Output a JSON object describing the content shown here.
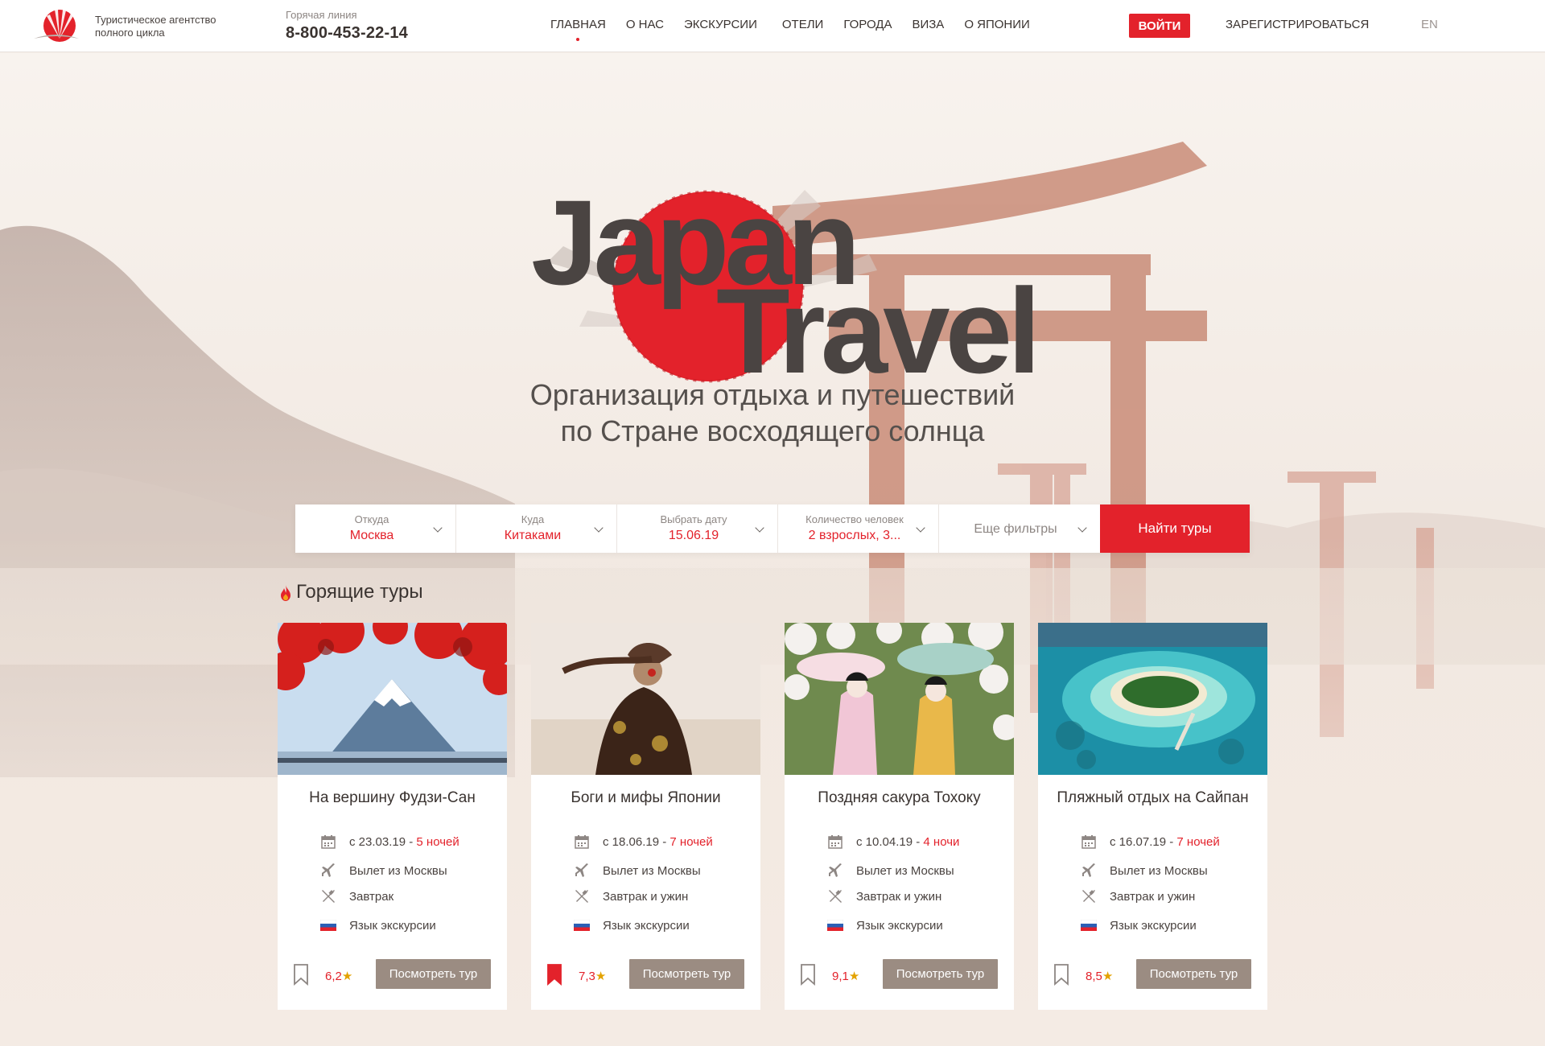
{
  "header": {
    "tagline": "Туристическое агентство полного цикла",
    "hotline_label": "Горячая линия",
    "hotline_number": "8-800-453-22-14",
    "nav": [
      "ГЛАВНАЯ",
      "О НАС",
      "ЭКСКУРСИИ",
      "ОТЕЛИ",
      "ГОРОДА",
      "ВИЗА",
      "О ЯПОНИИ"
    ],
    "active_nav": "ГЛАВНАЯ",
    "login": "ВОЙТИ",
    "register": "ЗАРЕГИСТРИРОВАТЬСЯ",
    "lang": "EN"
  },
  "hero": {
    "brand_word_1": "Japan",
    "brand_word_2": "Travel",
    "subtitle_line_1": "Организация отдыха  и путешествий",
    "subtitle_line_2": "по Стране восходящего солнца"
  },
  "search": {
    "from_label": "Откуда",
    "from_value": "Москва",
    "to_label": "Куда",
    "to_value": "Китаками",
    "date_label": "Выбрать дату",
    "date_value": "15.06.19",
    "people_label": "Количество человек",
    "people_value": "2 взрослых, 3...",
    "more_filters": "Еще фильтры",
    "submit": "Найти туры"
  },
  "hot_tours": {
    "title": "Горящие туры",
    "cards": [
      {
        "title": "На вершину Фудзи-Сан",
        "date": "с 23.03.19",
        "nights": "5 ночей",
        "flight": "Вылет из Москвы",
        "meals": "Завтрак",
        "language": "Язык экскурсии",
        "rating": "6,2",
        "bookmarked": false,
        "button": "Посмотреть тур"
      },
      {
        "title": "Боги и мифы Японии",
        "date": "с 18.06.19",
        "nights": "7 ночей",
        "flight": "Вылет из Москвы",
        "meals": "Завтрак и ужин",
        "language": "Язык экскурсии",
        "rating": "7,3",
        "bookmarked": true,
        "button": "Посмотреть тур"
      },
      {
        "title": "Поздняя сакура Тохоку",
        "date": "с 10.04.19",
        "nights": "4 ночи",
        "flight": "Вылет из Москвы",
        "meals": "Завтрак и ужин",
        "language": "Язык экскурсии",
        "rating": "9,1",
        "bookmarked": false,
        "button": "Посмотреть тур"
      },
      {
        "title": "Пляжный отдых на Сайпан",
        "date": "с 16.07.19",
        "nights": "7 ночей",
        "flight": "Вылет из Москвы",
        "meals": "Завтрак и ужин",
        "language": "Язык экскурсии",
        "rating": "8,5",
        "bookmarked": false,
        "button": "Посмотреть тур"
      }
    ]
  },
  "colors": {
    "accent": "#e3222b",
    "button_muted": "#9b8c82",
    "background": "#f6efe9"
  },
  "icons": {
    "logo": "rising-sun-logo",
    "hot": "fire-icon",
    "date": "calendar-icon",
    "flight": "airplane-icon",
    "meals": "fork-knife-icon",
    "language": "russian-flag-icon",
    "bookmark": "bookmark-icon",
    "rating": "star-icon"
  }
}
